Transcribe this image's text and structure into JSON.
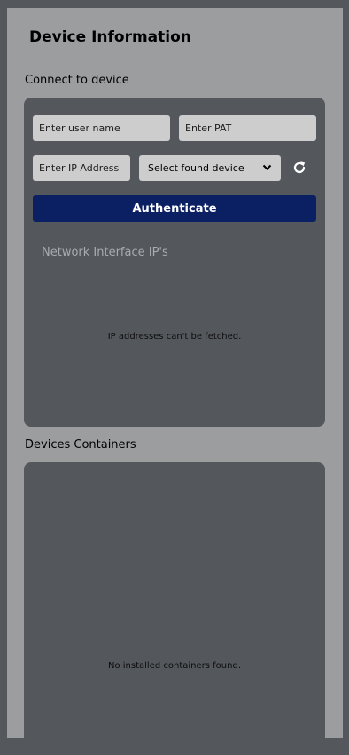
{
  "page": {
    "title": "Device Information"
  },
  "connect": {
    "section_label": "Connect to device",
    "username_placeholder": "Enter user name",
    "pat_placeholder": "Enter PAT",
    "ip_placeholder": "Enter IP Address",
    "device_select_value": "Select found device",
    "refresh_icon": "refresh-icon",
    "authenticate_label": "Authenticate",
    "authenticate_color": "#0b1f63"
  },
  "network": {
    "title": "Network Interface IP's",
    "empty_message": "IP addresses can't be fetched."
  },
  "containers": {
    "section_label": "Devices Containers",
    "empty_message": "No installed containers found."
  },
  "colors": {
    "background": "#54575c",
    "panel": "#9c9d9f",
    "card": "#54575c",
    "field": "#cdcdcd"
  }
}
